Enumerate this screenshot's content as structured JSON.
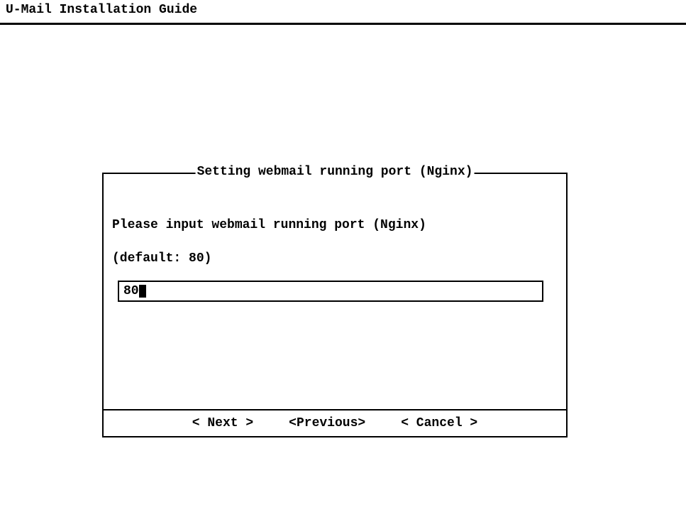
{
  "header": {
    "title": "U-Mail Installation Guide"
  },
  "dialog": {
    "title": "Setting webmail running port (Nginx)",
    "prompt_line1": "Please input webmail running port (Nginx)",
    "prompt_line2": "(default: 80)",
    "input_value": "80"
  },
  "buttons": {
    "next": "<  Next  >",
    "previous": "<Previous>",
    "cancel": "< Cancel >"
  }
}
